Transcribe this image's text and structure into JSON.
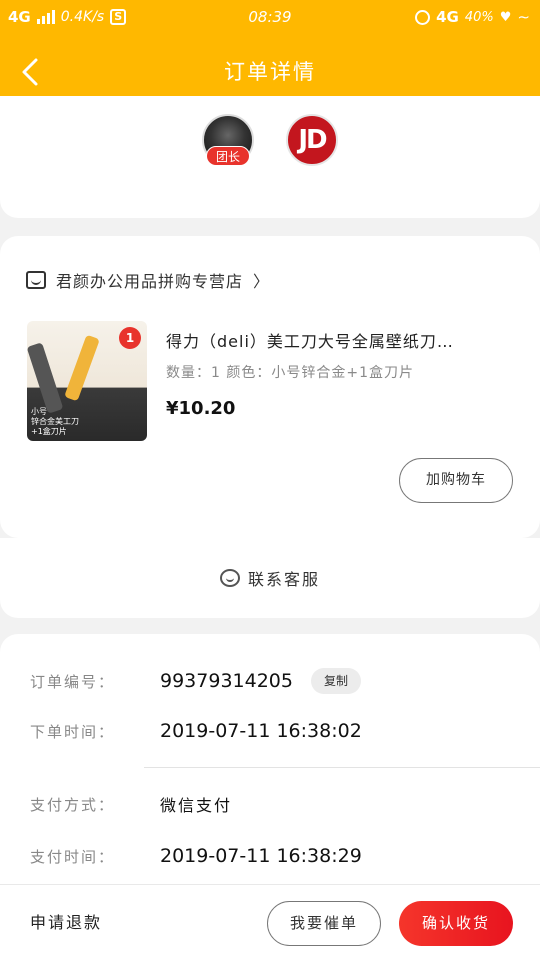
{
  "status_bar": {
    "network": "4G",
    "speed": "0.4K/s",
    "s_icon": "S",
    "time": "08:39",
    "network_right": "4G",
    "battery": "40%"
  },
  "header": {
    "title": "订单详情",
    "back_icon": "chevron-left-icon",
    "background": "#FFB800"
  },
  "group": {
    "leader_badge": "团长",
    "jd_logo": "JD"
  },
  "shop": {
    "name": "君颜办公用品拼购专营店",
    "arrow": "〉"
  },
  "product": {
    "title": "得力（deli）美工刀大号全属壁纸刀…",
    "spec": "数量：1  颜色：小号锌合金+1盒刀片",
    "price": "¥10.20",
    "image_caption_1": "小号",
    "image_caption_2": "锌合金美工刀",
    "image_caption_3": "+1盒刀片",
    "image_badge": "1",
    "cart_button": "加购物车"
  },
  "customer_service": {
    "label": "联系客服"
  },
  "order": {
    "number_label": "订单编号：",
    "number": "99379314205",
    "copy_button": "复制",
    "order_time_label": "下单时间：",
    "order_time": "2019-07-11 16:38:02",
    "pay_method_label": "支付方式：",
    "pay_method": "微信支付",
    "pay_time_label": "支付时间：",
    "pay_time": "2019-07-11 16:38:29"
  },
  "footer": {
    "refund": "申请退款",
    "urge_button": "我要催单",
    "confirm_button": "确认收货",
    "confirm_color": "#F0252A"
  }
}
